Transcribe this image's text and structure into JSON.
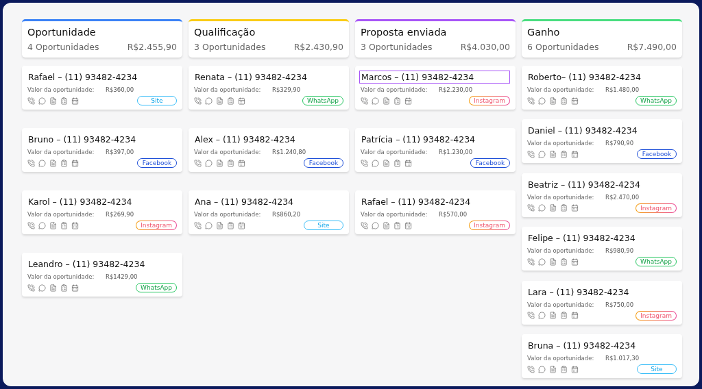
{
  "columns": [
    {
      "title": "Oportunidade",
      "count": "4 Oportunidades",
      "total": "R$2.455,90",
      "color": "#3b82f6",
      "cards": [
        {
          "name": "Rafael – (11) 93482-4234",
          "label": "Valor da oportunidade:",
          "value": "R$360,00",
          "source": {
            "kind": "site",
            "label": "Site"
          },
          "focused": false
        },
        {
          "name": "Bruno – (11) 93482-4234",
          "label": "Valor da oportunidade:",
          "value": "R$397,00",
          "source": {
            "kind": "facebook",
            "label": "Facebook"
          },
          "focused": false
        },
        {
          "name": "Karol – (11) 93482-4234",
          "label": "Valor da oportunidade:",
          "value": "R$269,90",
          "source": {
            "kind": "instagram",
            "label": "Instagram"
          },
          "focused": false
        },
        {
          "name": "Leandro – (11) 93482-4234",
          "label": "Valor da oportunidade:",
          "value": "R$1429,00",
          "source": {
            "kind": "whatsapp",
            "label": "WhatsApp"
          },
          "focused": false
        }
      ]
    },
    {
      "title": "Qualificação",
      "count": "3 Oportunidades",
      "total": "R$2.430,90",
      "color": "#facc15",
      "cards": [
        {
          "name": "Renata – (11) 93482-4234",
          "label": "Valor da oportunidade:",
          "value": "R$329,90",
          "source": {
            "kind": "whatsapp",
            "label": "WhatsApp"
          },
          "focused": false
        },
        {
          "name": "Alex – (11) 93482-4234",
          "label": "Valor da oportunidade:",
          "value": "R$1.240,80",
          "source": {
            "kind": "facebook",
            "label": "Facebook"
          },
          "focused": false
        },
        {
          "name": "Ana – (11) 93482-4234",
          "label": "Valor da oportunidade:",
          "value": "R$860,20",
          "source": {
            "kind": "site",
            "label": "Site"
          },
          "focused": false
        }
      ]
    },
    {
      "title": "Proposta enviada",
      "count": "3 Oportunidades",
      "total": "R$4.030,00",
      "color": "#a855f7",
      "cards": [
        {
          "name": "Marcos – (11) 93482-4234",
          "label": "Valor da oportunidade:",
          "value": "R$2.230,00",
          "source": {
            "kind": "instagram",
            "label": "Instagram"
          },
          "focused": true
        },
        {
          "name": "Patrícia – (11) 93482-4234",
          "label": "Valor da oportunidade:",
          "value": "R$1.230,00",
          "source": {
            "kind": "facebook",
            "label": "Facebook"
          },
          "focused": false
        },
        {
          "name": "Rafael – (11) 93482-4234",
          "label": "Valor da oportunidade:",
          "value": "R$570,00",
          "source": {
            "kind": "instagram",
            "label": "Instagram"
          },
          "focused": false
        }
      ]
    },
    {
      "title": "Ganho",
      "count": "6 Oportunidades",
      "total": "R$7.490,00",
      "color": "#4ade80",
      "cards": [
        {
          "name": "Roberto– (11) 93482-4234",
          "label": "Valor da oportunidade:",
          "value": "R$1.480,00",
          "source": {
            "kind": "whatsapp",
            "label": "WhatsApp"
          },
          "focused": false
        },
        {
          "name": "Daniel – (11) 93482-4234",
          "label": "Valor da oportunidade:",
          "value": "R$790,90",
          "source": {
            "kind": "facebook",
            "label": "Facebook"
          },
          "focused": false
        },
        {
          "name": "Beatriz – (11) 93482-4234",
          "label": "Valor da oportunidade:",
          "value": "R$2.470,00",
          "source": {
            "kind": "instagram",
            "label": "Instagram"
          },
          "focused": false
        },
        {
          "name": "Felipe – (11) 93482-4234",
          "label": "Valor da oportunidade:",
          "value": "R$980,90",
          "source": {
            "kind": "whatsapp",
            "label": "WhatsApp"
          },
          "focused": false
        },
        {
          "name": "Lara – (11) 93482-4234",
          "label": "Valor da oportunidade:",
          "value": "R$750,00",
          "source": {
            "kind": "instagram",
            "label": "Instagram"
          },
          "focused": false
        },
        {
          "name": "Bruna – (11) 93482-4234",
          "label": "Valor da oportunidade:",
          "value": "R$1.017,30",
          "source": {
            "kind": "site",
            "label": "Site"
          },
          "focused": false
        }
      ]
    }
  ]
}
